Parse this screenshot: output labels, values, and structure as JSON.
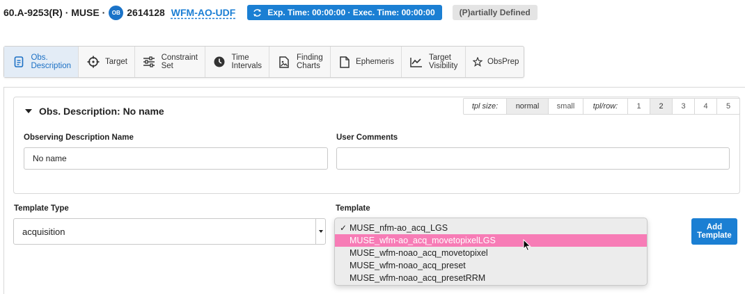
{
  "header": {
    "id_text": "60.A-9253(R) · MUSE ·",
    "ob_badge": "OB",
    "ob_number": "2614128",
    "ob_name": "WFM-AO-UDF",
    "time_pill": "Exp. Time: 00:00:00 · Exec. Time: 00:00:00",
    "status": "(P)artially Defined"
  },
  "tabs": [
    {
      "label": "Obs.\nDescription",
      "icon": "document-icon",
      "active": true
    },
    {
      "label": "Target",
      "icon": "crosshair-icon"
    },
    {
      "label": "Constraint\nSet",
      "icon": "sliders-icon"
    },
    {
      "label": "Time\nIntervals",
      "icon": "clock-icon"
    },
    {
      "label": "Finding\nCharts",
      "icon": "image-file-icon"
    },
    {
      "label": "Ephemeris",
      "icon": "file-icon"
    },
    {
      "label": "Target\nVisibility",
      "icon": "line-chart-icon"
    },
    {
      "label": "ObsPrep",
      "icon": "star-icon"
    }
  ],
  "panel": {
    "title": "Obs. Description: No name",
    "tpl_size_label": "tpl size:",
    "tpl_size_options": [
      "normal",
      "small"
    ],
    "tpl_size_selected": "normal",
    "tpl_row_label": "tpl/row:",
    "tpl_row_options": [
      "1",
      "2",
      "3",
      "4",
      "5"
    ],
    "tpl_row_selected": "2",
    "name_label": "Observing Description Name",
    "name_value": "No name",
    "comments_label": "User Comments",
    "comments_value": ""
  },
  "template_section": {
    "type_label": "Template Type",
    "type_value": "acquisition",
    "template_label": "Template",
    "options": [
      "MUSE_nfm-ao_acq_LGS",
      "MUSE_wfm-ao_acq_movetopixelLGS",
      "MUSE_wfm-noao_acq_movetopixel",
      "MUSE_wfm-noao_acq_preset",
      "MUSE_wfm-noao_acq_presetRRM"
    ],
    "checked_index": 0,
    "highlighted_index": 1,
    "check_mark": "✓",
    "add_button": "Add\nTemplate"
  },
  "colors": {
    "accent": "#1b7fd3",
    "highlight": "#f77cb6",
    "status_bg": "#e4e4e4"
  }
}
